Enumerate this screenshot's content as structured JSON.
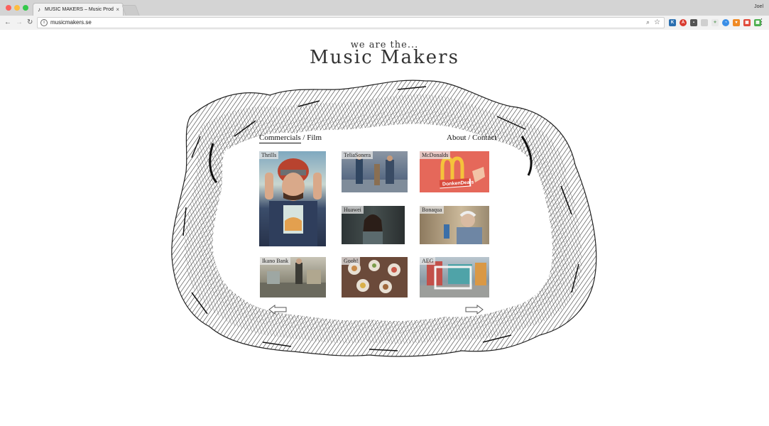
{
  "browser": {
    "tab_title": "MUSIC MAKERS – Music Prod",
    "tab_close": "×",
    "user_name": "Joel",
    "url": "musicmakers.se"
  },
  "header": {
    "tagline": "we are the...",
    "brand": "Music Makers"
  },
  "nav": {
    "commercials": "Commercials",
    "separator": "/",
    "film": "Film",
    "about": "About",
    "contact": "Contact"
  },
  "grid": {
    "items": [
      {
        "label": "Thrills"
      },
      {
        "label": "TeliaSonera"
      },
      {
        "label": "McDonalds"
      },
      {
        "label": "Huawei"
      },
      {
        "label": "Bonaqua"
      },
      {
        "label": "Ikano Bank"
      },
      {
        "label": "Gooh!"
      },
      {
        "label": "AEG"
      }
    ],
    "mcdonalds_badge": "DonkenDeals"
  },
  "arrows": {
    "prev_icon": "left-arrow-icon",
    "next_icon": "right-arrow-icon"
  },
  "colors": {
    "mcdonalds_red": "#e5685a",
    "mcdonalds_gold": "#f5c33b",
    "ink": "#222222"
  }
}
